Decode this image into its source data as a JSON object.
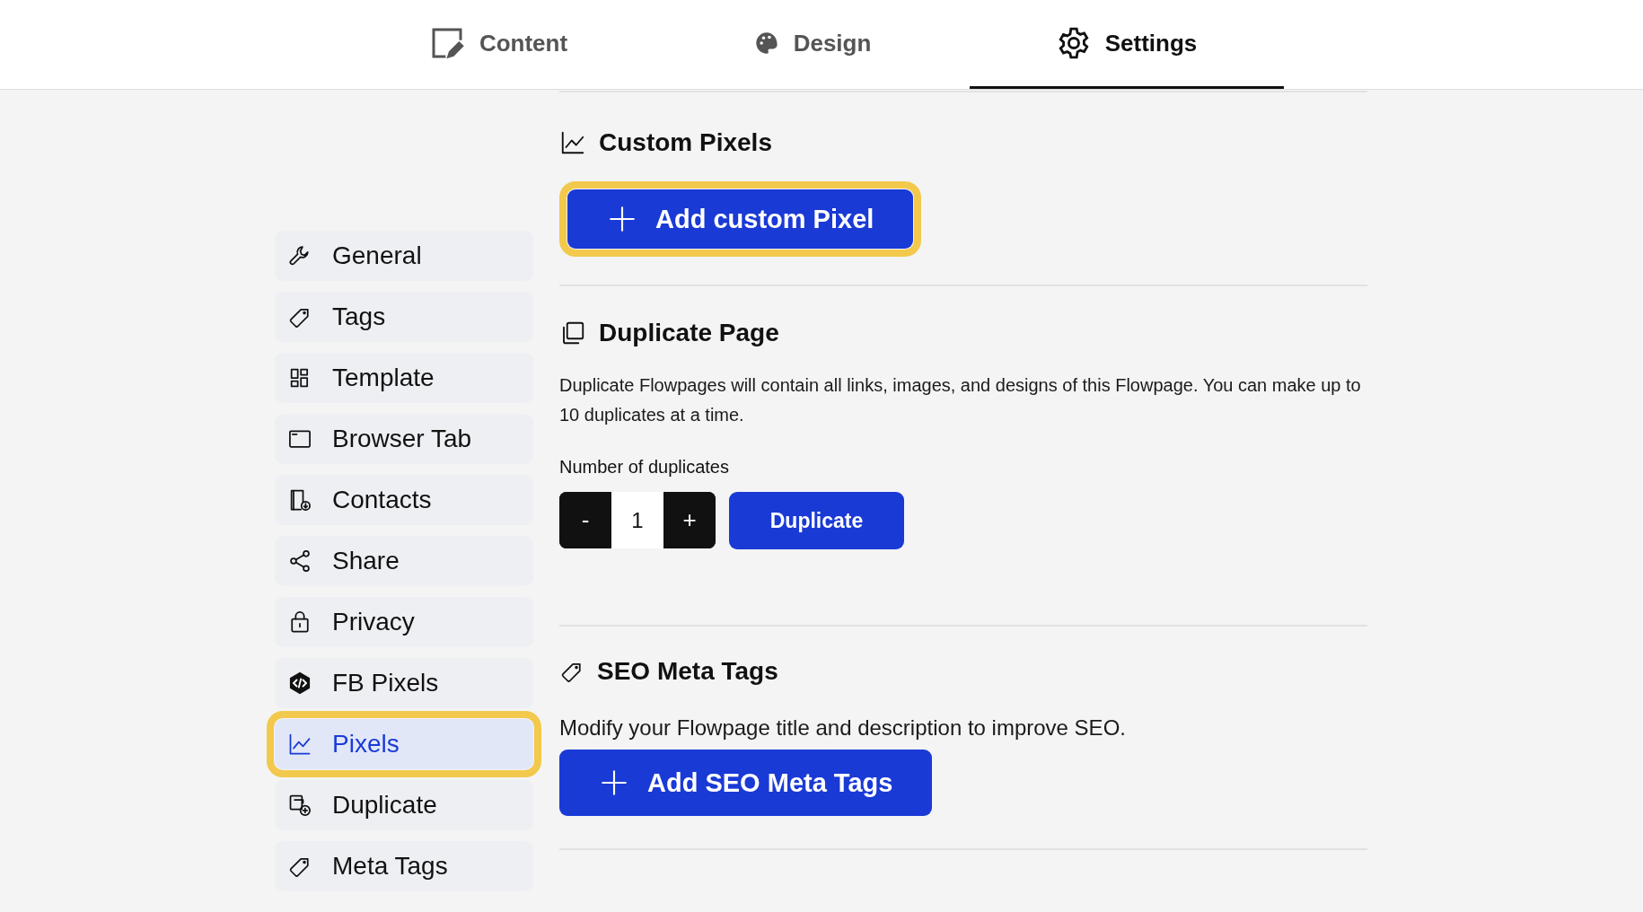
{
  "tabs": [
    {
      "label": "Content",
      "selected": false
    },
    {
      "label": "Design",
      "selected": false
    },
    {
      "label": "Settings",
      "selected": true
    }
  ],
  "sidebar": {
    "items": [
      {
        "label": "General",
        "selected": false,
        "highlighted": false
      },
      {
        "label": "Tags",
        "selected": false,
        "highlighted": false
      },
      {
        "label": "Template",
        "selected": false,
        "highlighted": false
      },
      {
        "label": "Browser Tab",
        "selected": false,
        "highlighted": false
      },
      {
        "label": "Contacts",
        "selected": false,
        "highlighted": false
      },
      {
        "label": "Share",
        "selected": false,
        "highlighted": false
      },
      {
        "label": "Privacy",
        "selected": false,
        "highlighted": false
      },
      {
        "label": "FB Pixels",
        "selected": false,
        "highlighted": false
      },
      {
        "label": "Pixels",
        "selected": true,
        "highlighted": true
      },
      {
        "label": "Duplicate",
        "selected": false,
        "highlighted": false
      },
      {
        "label": "Meta Tags",
        "selected": false,
        "highlighted": false
      }
    ]
  },
  "custom_pixels": {
    "title": "Custom Pixels",
    "button": {
      "label": "Add custom Pixel",
      "highlighted": true
    }
  },
  "duplicate_page": {
    "title": "Duplicate Page",
    "description": "Duplicate Flowpages will contain all links, images, and designs of this Flowpage. You can make up to 10 duplicates at a time.",
    "count_label": "Number of duplicates",
    "decrement": "-",
    "count": "1",
    "increment": "+",
    "button": "Duplicate"
  },
  "seo_meta_tags": {
    "title": "SEO Meta Tags",
    "description": "Modify your Flowpage title and description to improve SEO.",
    "button": {
      "label": "Add SEO Meta Tags",
      "highlighted": false
    }
  }
}
